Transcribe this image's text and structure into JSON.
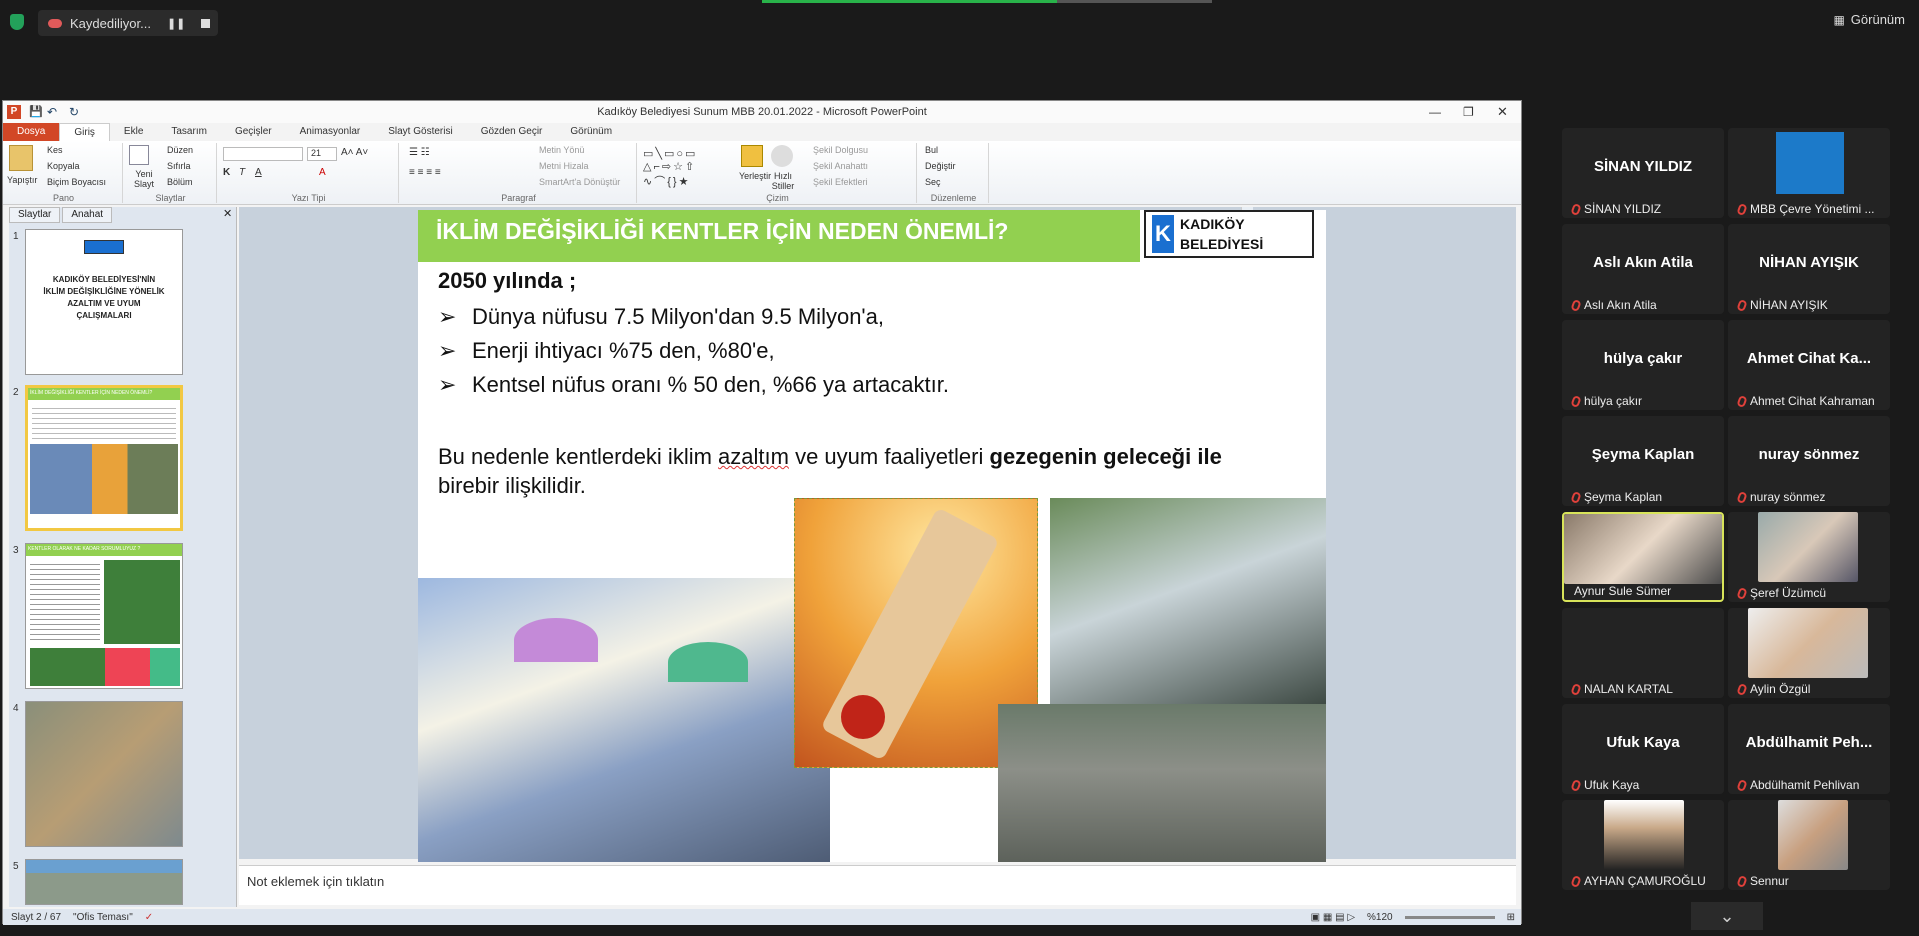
{
  "zoom": {
    "recording_label": "Kaydediliyor...",
    "view_label": "Görünüm"
  },
  "window": {
    "title": "Kadıköy Belediyesi Sunum MBB 20.01.2022 - Microsoft PowerPoint"
  },
  "ribbon_tabs": [
    "Dosya",
    "Giriş",
    "Ekle",
    "Tasarım",
    "Geçişler",
    "Animasyonlar",
    "Slayt Gösterisi",
    "Gözden Geçir",
    "Görünüm"
  ],
  "ribbon": {
    "paste": "Yapıştır",
    "cut": "Kes",
    "copy": "Kopyala",
    "format_painter": "Biçim Boyacısı",
    "group_clipboard": "Pano",
    "new_slide": "Yeni Slayt",
    "layout": "Düzen",
    "reset": "Sıfırla",
    "section": "Bölüm",
    "group_slides": "Slaytlar",
    "group_font": "Yazı Tipi",
    "font_size": "21",
    "text_direction": "Metin Yönü",
    "align_text": "Metni Hizala",
    "smartart": "SmartArt'a Dönüştür",
    "group_paragraph": "Paragraf",
    "arrange": "Yerleştir",
    "quick_styles": "Hızlı Stiller",
    "shape_fill": "Şekil Dolgusu",
    "shape_outline": "Şekil Anahattı",
    "shape_effects": "Şekil Efektleri",
    "group_drawing": "Çizim",
    "find": "Bul",
    "replace": "Değiştir",
    "select": "Seç",
    "group_editing": "Düzenleme"
  },
  "left_pane": {
    "tab_slides": "Slaytlar",
    "tab_outline": "Anahat",
    "thumbs": [
      {
        "num": "1",
        "text": "KADIKÖY BELEDİYESİ'NİN İKLİM DEĞİŞİKLİĞİNE YÖNELİK AZALTIM VE UYUM ÇALIŞMALARI"
      },
      {
        "num": "2",
        "text": "İKLİM DEĞİŞİKLİĞİ KENTLER İÇİN NEDEN ÖNEMLİ?"
      },
      {
        "num": "3",
        "text": "KENTLER OLARAK NE KADAR SORUMLUYUZ ?"
      },
      {
        "num": "4",
        "text": ""
      },
      {
        "num": "5",
        "text": ""
      }
    ]
  },
  "slide": {
    "heading": "İKLİM DEĞİŞİKLİĞİ KENTLER  İÇİN NEDEN ÖNEMLİ?",
    "logo_line1": "KADIKÖY",
    "logo_line2": "BELEDİYESİ",
    "subheading": "2050 yılında ;",
    "bullet_marker": "➢",
    "bullets": [
      "Dünya nüfusu 7.5  Milyon'dan 9.5 Milyon'a,",
      "Enerji ihtiyacı %75 den, %80'e,",
      "Kentsel nüfus oranı % 50 den, %66 ya artacaktır."
    ],
    "para_start": "Bu nedenle kentlerdeki iklim ",
    "para_u1": "azaltım",
    "para_mid": " ve uyum faaliyetleri ",
    "para_bold": "gezegenin geleceği ile",
    "para_end": "birebir ilişkilidir."
  },
  "notes_placeholder": "Not eklemek için tıklatın",
  "status": {
    "slide_counter": "Slayt 2 / 67",
    "theme": "\"Ofis Teması\"",
    "zoom": "%120"
  },
  "participants": [
    {
      "big": "SİNAN YILDIZ",
      "name": "SİNAN YILDIZ"
    },
    {
      "big": "",
      "name": "MBB Çevre Yönetimi ..."
    },
    {
      "big": "Aslı Akın Atila",
      "name": "Aslı Akın Atila"
    },
    {
      "big": "NİHAN AYIŞIK",
      "name": "NİHAN AYIŞIK"
    },
    {
      "big": "hülya çakır",
      "name": "hülya çakır"
    },
    {
      "big": "Ahmet Cihat Ka...",
      "name": "Ahmet Cihat Kahraman"
    },
    {
      "big": "Şeyma Kaplan",
      "name": "Şeyma Kaplan"
    },
    {
      "big": "nuray sönmez",
      "name": "nuray sönmez"
    },
    {
      "big": "",
      "name": "Aynur Sule Sümer"
    },
    {
      "big": "",
      "name": "Şeref Üzümcü"
    },
    {
      "big": "",
      "name": "NALAN KARTAL"
    },
    {
      "big": "",
      "name": "Aylin Özgül"
    },
    {
      "big": "Ufuk Kaya",
      "name": "Ufuk Kaya"
    },
    {
      "big": "Abdülhamit  Peh...",
      "name": "Abdülhamit Pehlivan"
    },
    {
      "big": "",
      "name": "AYHAN ÇAMUROĞLU"
    },
    {
      "big": "",
      "name": "Sennur"
    }
  ]
}
